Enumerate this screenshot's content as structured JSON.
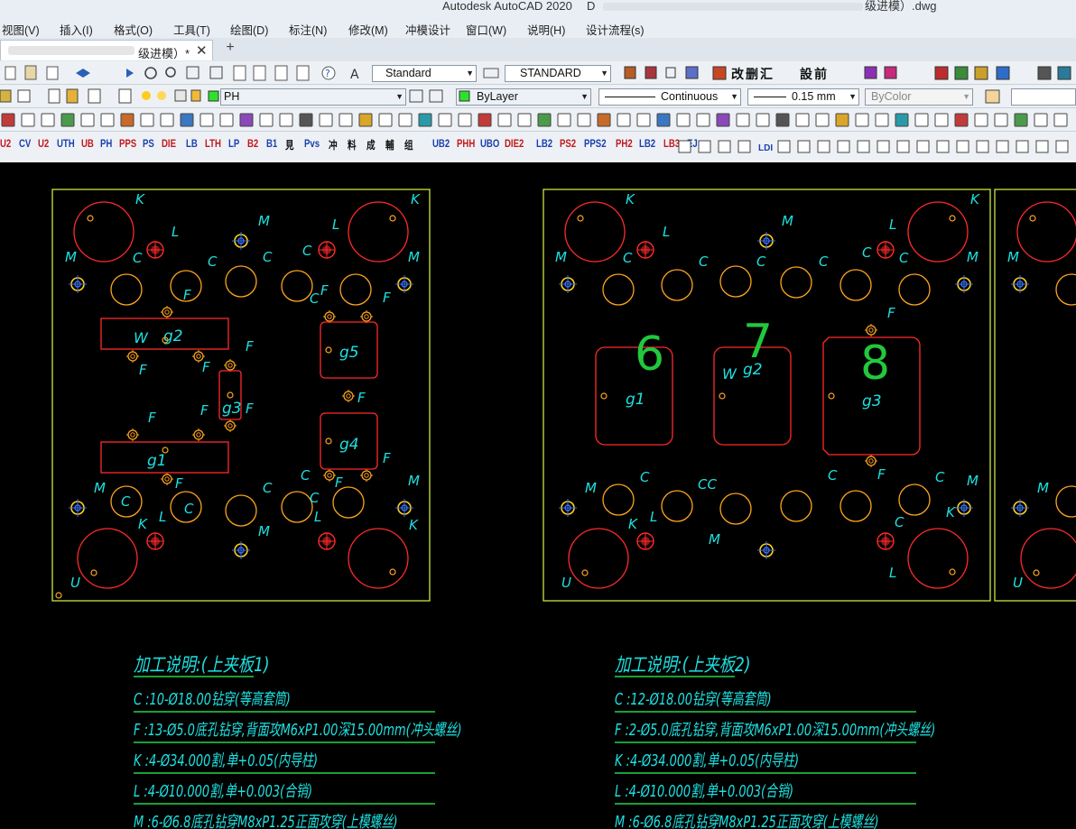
{
  "window": {
    "app_title": "Autodesk AutoCAD 2020",
    "doc_prefix": "D",
    "doc_suffix": "级进模）.dwg"
  },
  "menu": [
    {
      "id": "view",
      "label": "视图(V)"
    },
    {
      "id": "insert",
      "label": "插入(I)"
    },
    {
      "id": "format",
      "label": "格式(O)"
    },
    {
      "id": "tools",
      "label": "工具(T)"
    },
    {
      "id": "draw",
      "label": "绘图(D)"
    },
    {
      "id": "dimension",
      "label": "标注(N)"
    },
    {
      "id": "modify",
      "label": "修改(M)"
    },
    {
      "id": "punch_design",
      "label": "冲模设计"
    },
    {
      "id": "window",
      "label": "窗口(W)"
    },
    {
      "id": "help",
      "label": "说明(H)"
    },
    {
      "id": "design_flow",
      "label": "设计流程(s)"
    }
  ],
  "tab": {
    "label": "级进模）*",
    "close": "✕",
    "new": "+"
  },
  "toolbar": {
    "text_style": "Standard",
    "dim_style": "STANDARD",
    "layer": "PH",
    "color": "ByLayer",
    "linetype": "Continuous",
    "lineweight": "0.15 mm",
    "plot_style": "ByColor",
    "punch_row1": [
      "改",
      "删",
      "汇",
      "設",
      "前"
    ],
    "punch_row2": [
      "U2",
      "CV",
      "U2",
      "UTH",
      "UB",
      "PH",
      "PPS",
      "PS",
      "DIE",
      "LB",
      "LTH",
      "LP",
      "B2",
      "B1",
      "見",
      "Pvs",
      "冲",
      "料",
      "成",
      "輔",
      "组"
    ],
    "punch_row3": [
      "UB2",
      "PHH",
      "UBO",
      "DIE2",
      "LB2",
      "PS2",
      "PPS2",
      "PH2",
      "LB2",
      "LB3",
      "EJ"
    ],
    "ldi": "LDI"
  },
  "colors": {
    "plate_border": "#c8e63c",
    "hole_red": "#ff2a2a",
    "hole_orange": "#ffa51e",
    "label_cyan": "#1ee1e1",
    "note_green": "#22d44a",
    "handwriting": "#22c83c",
    "target_yellow": "#ffd21e"
  },
  "drawing": {
    "plate1": {
      "letters": {
        "K": "K",
        "L": "L",
        "M": "M",
        "C": "C",
        "F": "F",
        "W": "W",
        "U": "U",
        "CC": "CC"
      },
      "cavities": [
        "g2",
        "g5",
        "g3",
        "g4",
        "g1"
      ]
    },
    "plate2": {
      "cavities": [
        "g1",
        "g2",
        "g3"
      ],
      "handwritten": [
        "6",
        "7",
        "8"
      ]
    }
  },
  "notes": [
    {
      "title": "加工说明:(上夹板1)",
      "lines": [
        "C :10-Ø18.00钻穿(等高套筒)",
        "F :13-Ø5.0底孔钻穿,背面攻M6xP1.00深15.00mm(冲头螺丝)",
        "K :4-Ø34.000割,单+0.05(内导柱)",
        "L :4-Ø10.000割,单+0.003(合销)",
        "M :6-Ø6.8底孔钻穿M8xP1.25正面攻穿(上模螺丝)"
      ]
    },
    {
      "title": "加工说明:(上夹板2)",
      "lines": [
        "C :12-Ø18.00钻穿(等高套筒)",
        "F :2-Ø5.0底孔钻穿,背面攻M6xP1.00深15.00mm(冲头螺丝)",
        "K :4-Ø34.000割,单+0.05(内导柱)",
        "L :4-Ø10.000割,单+0.003(合销)",
        "M :6-Ø6.8底孔钻穿M8xP1.25正面攻穿(上模螺丝)"
      ]
    }
  ]
}
